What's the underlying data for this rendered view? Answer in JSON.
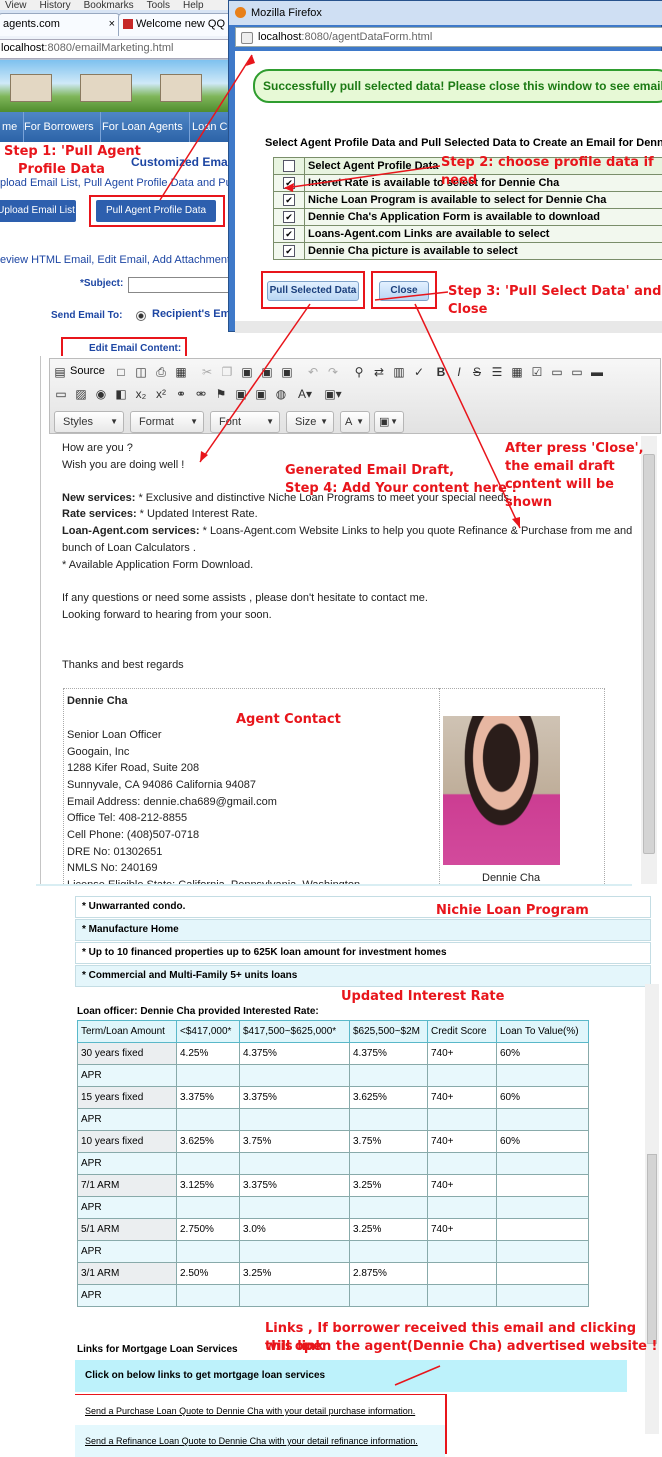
{
  "browser": {
    "menu": [
      "View",
      "History",
      "Bookmarks",
      "Tools",
      "Help"
    ],
    "tabs": [
      {
        "label": "agents.com",
        "close": "×"
      },
      {
        "label": "Welcome new QQ us"
      }
    ],
    "url_host": "localhost",
    "url_rest": ":8080/emailMarketing.html"
  },
  "site": {
    "nav": [
      "me",
      "For Borrowers",
      "For Loan Agents",
      "Loan C"
    ],
    "heading": "Customized Emai",
    "subheading": "pload Email List, Pull Agent Profile Data and Pull",
    "upload_button": "Upload Email List",
    "pull_button": "Pull Agent Profile Data",
    "links_line": "eview HTML Email, Edit Email, Add Attachment ",
    "subject_label": "*Subject:",
    "send_to_label": "Send Email To:",
    "recipient_option": "Recipient's Em",
    "edit_content_label": "Edit Email Content:"
  },
  "popup": {
    "title": "Mozilla Firefox",
    "url_host": "localhost",
    "url_rest": ":8080/agentDataForm.html",
    "success": "Successfully pull selected data! Please close this window to see email co",
    "select_title": "Select Agent Profile Data and Pull Selected Data to Create an Email for Dennie",
    "header_label": "Select Agent Profile Data",
    "items": [
      "Interet Rate is available to select for Dennie Cha",
      "Niche Loan Program is available to select for Dennie Cha",
      "Dennie Cha's Application Form is available to download",
      "Loans-Agent.com Links are available to select",
      "Dennie Cha picture is available to select"
    ],
    "pull_selected": "Pull Selected Data",
    "close": "Close"
  },
  "annotations": {
    "step1": "Step 1: 'Pull Agent",
    "step1b": "Profile Data",
    "step2": "Step 2: choose profile data if need",
    "step3": "Step 3: 'Pull Select Data' and Close",
    "step4a": "Generated Email Draft,",
    "step4b": "Step 4: Add Your content here !",
    "after1": "After press 'Close',",
    "after2": "the email draft",
    "after3": "content will be shown",
    "agent_contact": "Agent Contact",
    "niche": "Nichie Loan Program",
    "updated_rate": "Updated Interest Rate",
    "links1": "Links , If borrower received this email and clicking this link",
    "links2": "will open the agent(Dennie Cha) advertised website !"
  },
  "editor": {
    "toolbar_source": "Source",
    "styles": "Styles",
    "format": "Format",
    "font": "Font",
    "size": "Size",
    "body": {
      "l1": "How are you ?",
      "l2": "Wish you are doing well !",
      "new_services_b": "New services:",
      "new_services": " * Exclusive and distinctive Niche Loan Programs to meet your special needs.",
      "rate_services_b": "Rate services:",
      "rate_services": " * Updated Interest Rate.",
      "la_services_b": "Loan-Agent.com services:",
      "la_services": " * Loans-Agent.com Website Links to help you quote Refinance & Purchase from me and",
      "la_services2": "bunch of Loan Calculators .",
      "app_form": "* Available Application Form Download.",
      "questions": "If any questions or need some assists , please don't hesitate to contact me.",
      "looking": "Looking forward to hearing from your soon.",
      "thanks": "Thanks and best regards"
    },
    "contact": {
      "name": "Dennie  Cha",
      "title": "Senior Loan Officer",
      "company": "Googain, Inc",
      "address1": "1288 Kifer Road, Suite 208",
      "address2": "Sunnyvale, CA 94086  California  94087",
      "email": "Email Address: dennie.cha689@gmail.com",
      "office": "Office Tel: 408-212-8855",
      "cell": "Cell Phone: (408)507-0718",
      "dre": "DRE No: 01302651",
      "nmls": "NMLS No: 240169",
      "license": "License Eligible State: California, Pennsylvania, Washington",
      "photo_caption": "Dennie  Cha"
    }
  },
  "programs": [
    "* Unwarranted condo.",
    "* Manufacture Home",
    "* Up to 10 financed properties up to 625K loan amount for investment homes",
    "* Commercial and Multi-Family 5+ units loans"
  ],
  "rate_table": {
    "caption": "Loan officer: Dennie  Cha  provided Interested Rate:",
    "headers": [
      "Term/Loan Amount",
      "<$417,000*",
      "$417,500~$625,000*",
      "$625,500~$2M",
      "Credit Score",
      "Loan To Value(%)"
    ],
    "rows": [
      [
        "30 years fixed",
        "4.25%",
        "4.375%",
        "4.375%",
        "740+",
        "60%"
      ],
      [
        "APR",
        "",
        "",
        "",
        "",
        ""
      ],
      [
        "15 years fixed",
        "3.375%",
        "3.375%",
        "3.625%",
        "740+",
        "60%"
      ],
      [
        "APR",
        "",
        "",
        "",
        "",
        ""
      ],
      [
        "10 years fixed",
        "3.625%",
        "3.75%",
        "3.75%",
        "740+",
        "60%"
      ],
      [
        "APR",
        "",
        "",
        "",
        "",
        ""
      ],
      [
        "7/1 ARM",
        "3.125%",
        "3.375%",
        "3.25%",
        "740+",
        ""
      ],
      [
        "APR",
        "",
        "",
        "",
        "",
        ""
      ],
      [
        "5/1 ARM",
        "2.750%",
        "3.0%",
        "3.25%",
        "740+",
        ""
      ],
      [
        "APR",
        "",
        "",
        "",
        "",
        ""
      ],
      [
        "3/1 ARM",
        "2.50%",
        "3.25%",
        "2.875%",
        "",
        ""
      ],
      [
        "APR",
        "",
        "",
        "",
        "",
        ""
      ]
    ]
  },
  "links": {
    "title": "Links for Mortgage Loan Services",
    "banner": "Click on below links to get mortgage loan services",
    "purchase": "Send a Purchase Loan Quote to Dennie Cha with your detail purchase information.",
    "refinance": "Send a Refinance Loan Quote to Dennie Cha with your detail refinance information."
  },
  "colors": {
    "annotation": "#e8151b",
    "nav": "#2c63a8",
    "success_border": "#2f9d2f"
  }
}
